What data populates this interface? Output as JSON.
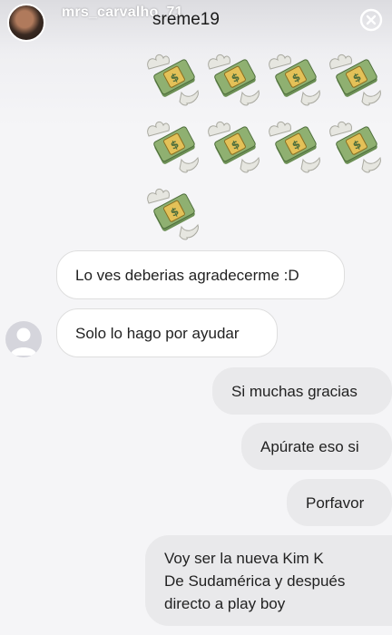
{
  "story": {
    "username": "mrs_carvalho_71",
    "chat_username": "sreme19"
  },
  "emoji": {
    "name": "money-with-wings",
    "count": 9
  },
  "messages": [
    {
      "side": "received",
      "text": "Lo ves deberias agradecerme :D"
    },
    {
      "side": "received",
      "text": "Solo lo hago por ayudar"
    },
    {
      "side": "sent",
      "text": "Si muchas gracias"
    },
    {
      "side": "sent",
      "text": "Apúrate eso si"
    },
    {
      "side": "sent",
      "text": "Porfavor"
    },
    {
      "side": "sent",
      "lines": [
        "Voy ser la nueva Kim K",
        "De Sudamérica y después",
        "directo a play boy"
      ]
    }
  ],
  "colors": {
    "sent_bubble": "#e9e9eb",
    "received_bubble": "#ffffff",
    "text": "#222222"
  }
}
